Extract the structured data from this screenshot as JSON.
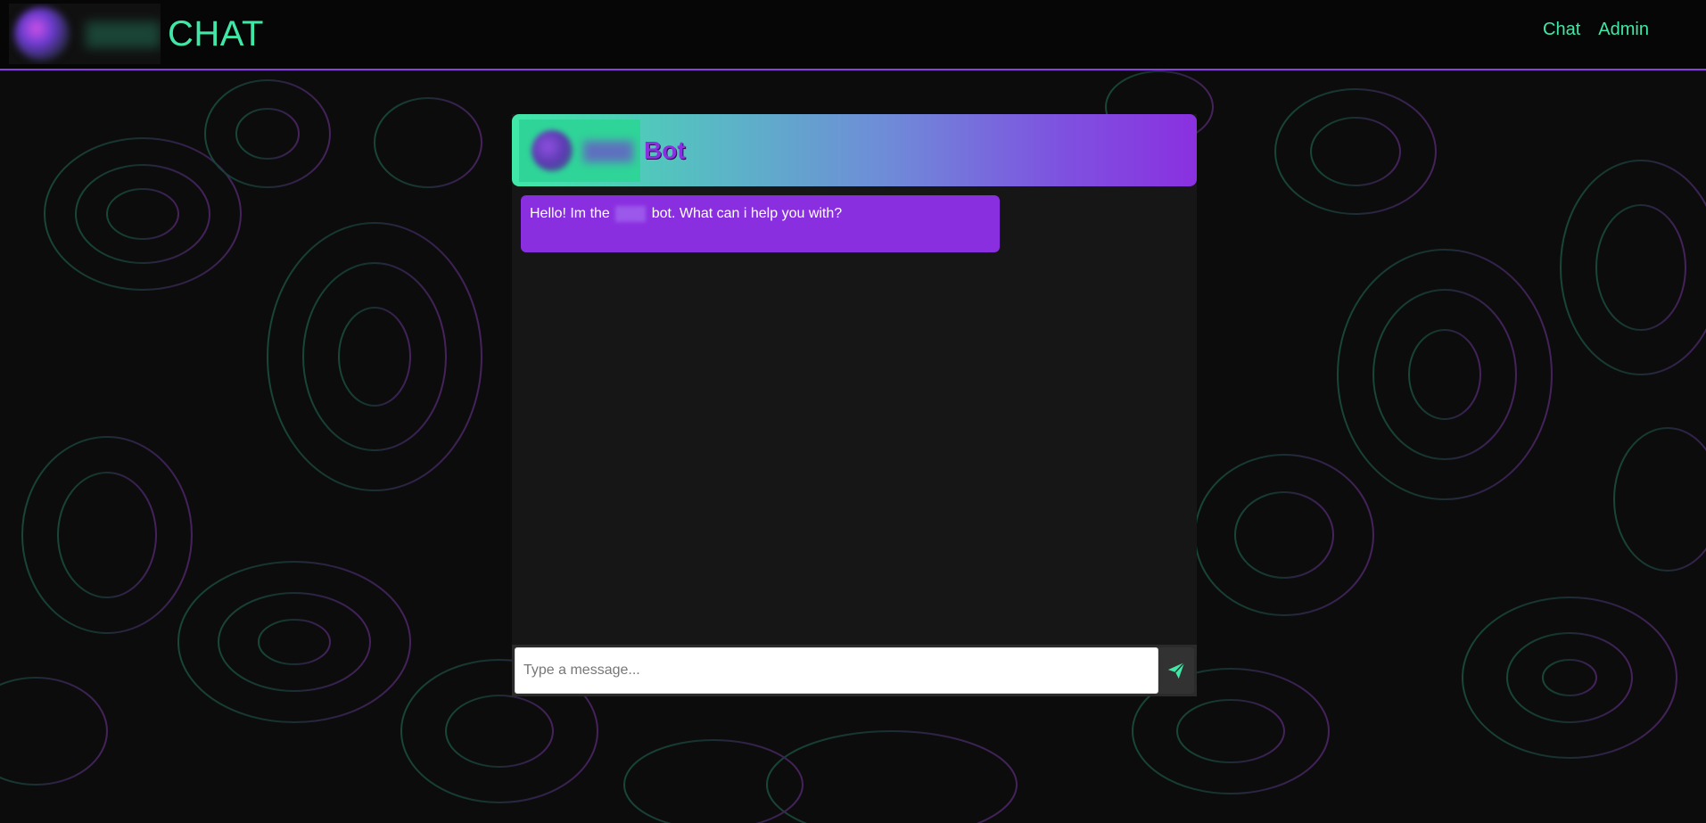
{
  "header": {
    "brand_title": "CHAT",
    "nav": [
      {
        "label": "Chat"
      },
      {
        "label": "Admin"
      }
    ]
  },
  "chat": {
    "bot_title": "Bot",
    "messages": [
      {
        "sender": "bot",
        "text_before": "Hello! Im the",
        "text_after": "bot. What can i help you with?"
      }
    ],
    "input": {
      "placeholder": "Type a message...",
      "value": ""
    },
    "send_icon": "paper-plane-icon"
  },
  "colors": {
    "accent_green": "#3fe8a6",
    "accent_purple": "#8a2fe0",
    "header_border": "#8a3fe6",
    "background": "#0c0c0c",
    "chat_background": "#161616"
  }
}
